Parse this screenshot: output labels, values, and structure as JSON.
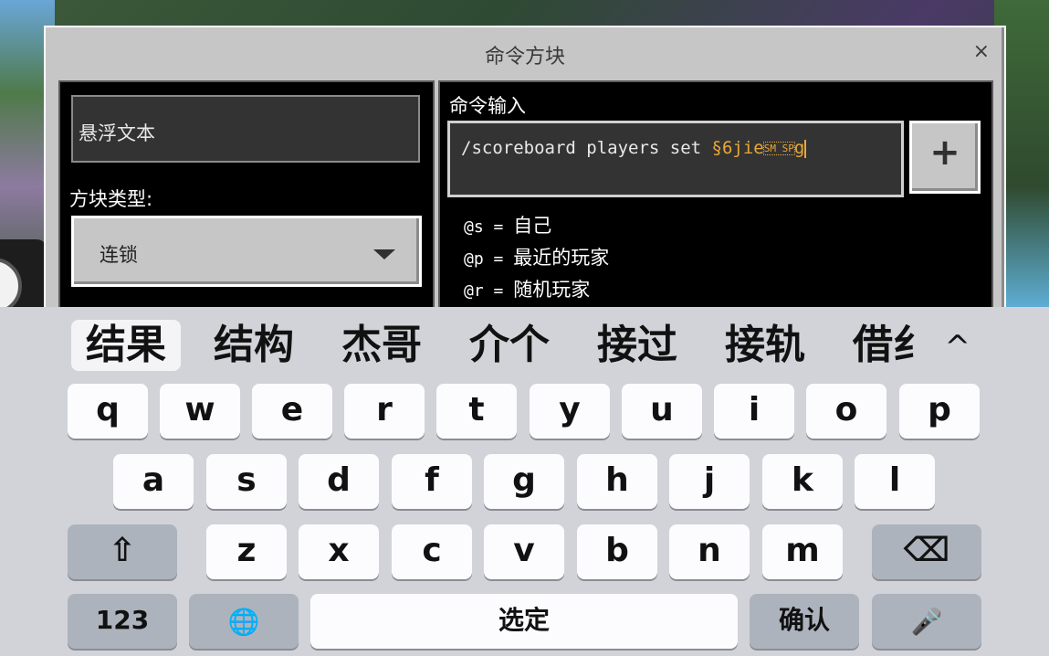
{
  "dialog": {
    "title": "命令方块",
    "close_symbol": "×",
    "hover_text": "悬浮文本",
    "block_type_label": "方块类型:",
    "block_type_value": "连锁",
    "command_input_label": "命令输入",
    "command_prefix": "/scoreboard players set ",
    "command_gold": "§6jie",
    "command_marked": "SM SP",
    "command_tail": "g",
    "add_symbol": "+",
    "help": [
      {
        "sel": "@s",
        "eq": " = ",
        "desc": "自己"
      },
      {
        "sel": "@p",
        "eq": " = ",
        "desc": "最近的玩家"
      },
      {
        "sel": "@r",
        "eq": " = ",
        "desc": "随机玩家"
      }
    ]
  },
  "keyboard": {
    "candidates": [
      "结果",
      "结构",
      "杰哥",
      "介个",
      "接过",
      "接轨",
      "借纟"
    ],
    "expand_symbol": "^",
    "row1": [
      "q",
      "w",
      "e",
      "r",
      "t",
      "y",
      "u",
      "i",
      "o",
      "p"
    ],
    "row2": [
      "a",
      "s",
      "d",
      "f",
      "g",
      "h",
      "j",
      "k",
      "l"
    ],
    "row3": [
      "z",
      "x",
      "c",
      "v",
      "b",
      "n",
      "m"
    ],
    "shift_symbol": "⇧",
    "delete_symbol": "⌫",
    "numbers_label": "123",
    "globe_symbol": "🌐",
    "space_label": "选定",
    "confirm_label": "确认",
    "mic_symbol": "🎤"
  },
  "colors": {
    "accent_gold": "#e8a838",
    "panel_gray": "#c6c6c6",
    "keyboard_bg": "#d1d3d9"
  }
}
